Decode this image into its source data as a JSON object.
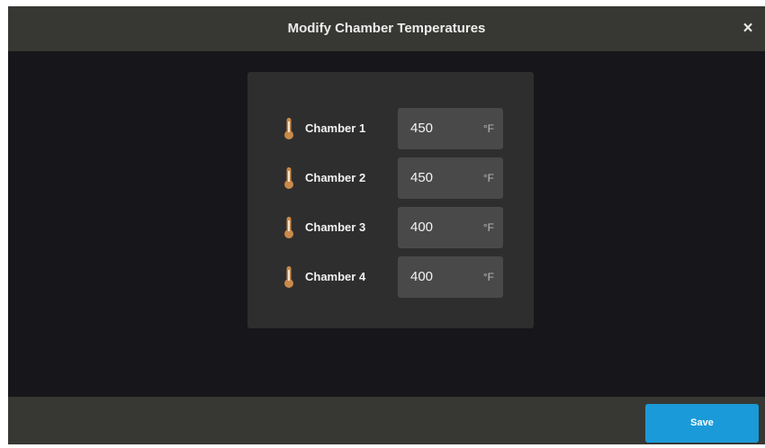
{
  "dialog": {
    "title": "Modify Chamber Temperatures",
    "close_label": "×"
  },
  "chambers": [
    {
      "label": "Chamber 1",
      "value": "450",
      "unit": "°F",
      "icon": "thermometer-icon"
    },
    {
      "label": "Chamber 2",
      "value": "450",
      "unit": "°F",
      "icon": "thermometer-icon"
    },
    {
      "label": "Chamber 3",
      "value": "400",
      "unit": "°F",
      "icon": "thermometer-icon"
    },
    {
      "label": "Chamber 4",
      "value": "400",
      "unit": "°F",
      "icon": "thermometer-icon"
    }
  ],
  "footer": {
    "save_label": "Save"
  },
  "colors": {
    "background": "#16161b",
    "bar": "#373733",
    "panel": "#2e2e2f",
    "field": "#49494a",
    "accent": "#1a9ad8",
    "thermometer": "#c98a4a"
  }
}
